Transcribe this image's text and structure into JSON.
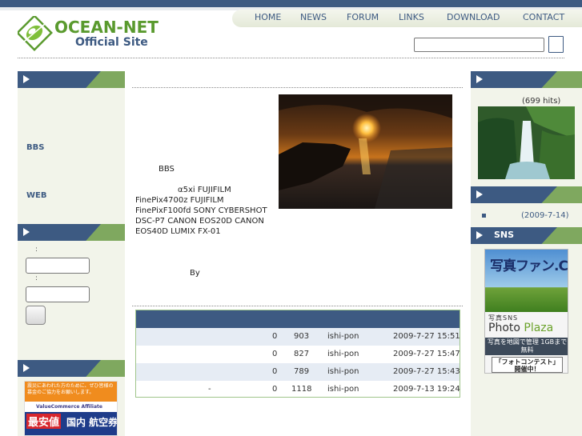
{
  "header": {
    "logo_title": "OCEAN-NET",
    "logo_subtitle": "Official Site",
    "nav": [
      {
        "label": "HOME"
      },
      {
        "label": "NEWS"
      },
      {
        "label": "FORUM"
      },
      {
        "label": "LINKS"
      },
      {
        "label": "DOWNLOAD"
      },
      {
        "label": "CONTACT"
      }
    ],
    "search": {
      "value": "",
      "placeholder": ""
    }
  },
  "left": {
    "links": [
      {
        "label": "BBS"
      },
      {
        "label": "WEB"
      }
    ],
    "login": {
      "label_user": ":",
      "label_pass": ":"
    },
    "banner": {
      "top_text": "震災にあわれた方のために、ぜひ皆様の募金のご協力をお願いします。",
      "brand": "ValueCommerce Affiliate",
      "red_text": "最安値",
      "white_text": "国内 航空券検索"
    }
  },
  "main": {
    "intro": {
      "line1": "BBS",
      "line2": "α5xi FUJIFILM",
      "line3": "FinePix4700z FUJIFILM",
      "line4": "FinePixF100fd SONY CYBERSHOT",
      "line5": "DSC-P7 CANON EOS20D CANON",
      "line6": "EOS40D LUMIX FX-01",
      "by": "By"
    },
    "table": {
      "rows": [
        {
          "title": "",
          "replies": "0",
          "views": "903",
          "author": "ishi-pon",
          "date": "2009-7-27 15:51"
        },
        {
          "title": "",
          "replies": "0",
          "views": "827",
          "author": "ishi-pon",
          "date": "2009-7-27 15:47"
        },
        {
          "title": "",
          "replies": "0",
          "views": "789",
          "author": "ishi-pon",
          "date": "2009-7-27 15:43"
        },
        {
          "title": "-",
          "replies": "0",
          "views": "1118",
          "author": "ishi-pon",
          "date": "2009-7-13 19:24"
        }
      ]
    }
  },
  "right": {
    "hits": "(699 hits)",
    "date": "(2009-7-14)",
    "sns_title": "SNS",
    "sns_banner": {
      "kanji": "写真ファン.COM",
      "t1": "写真SNS",
      "t2a": "Photo",
      "t2b": "Plaza",
      "t3": "写真を地図で管理 1GBまで無料",
      "t4": "「フォトコンテスト」開催中！"
    }
  },
  "colors": {
    "navy": "#3d5a82",
    "green": "#7fa85f",
    "sidebar_bg": "#f2f4ea",
    "row_alt": "#e6ecf4"
  },
  "icons": [
    "ocean-net-logo-icon",
    "arrow-right-icon"
  ]
}
